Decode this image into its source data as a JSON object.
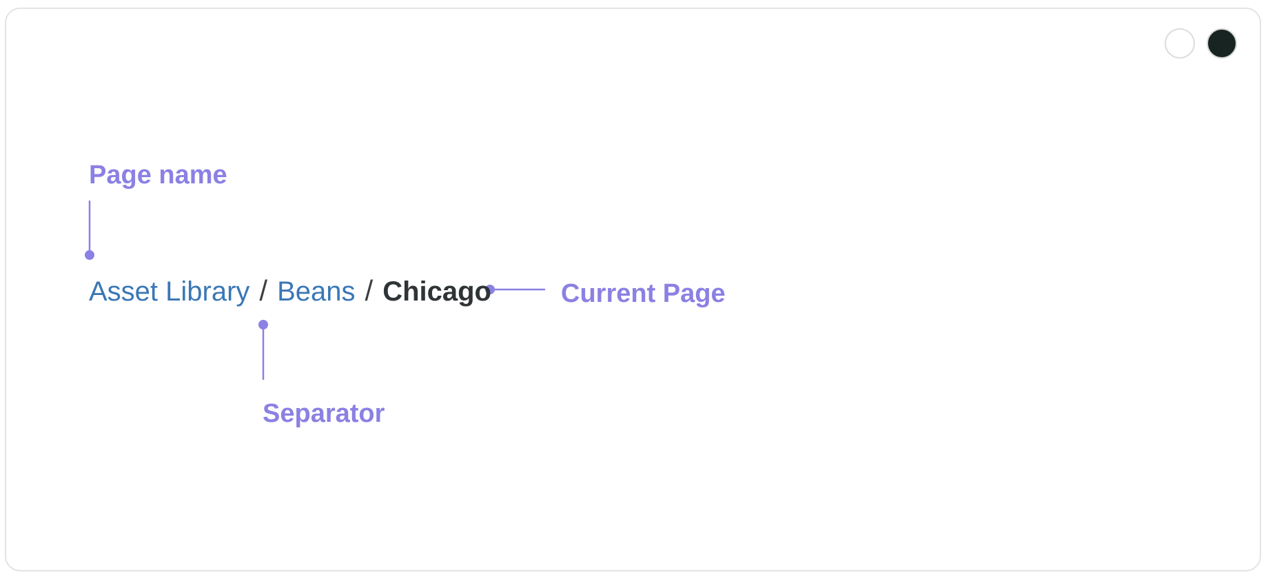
{
  "colors": {
    "annotation": "#8b80e3",
    "link": "#3a77b6",
    "separator": "#3b3f42",
    "current": "#2f3437",
    "frame_border": "#e3e3e3",
    "toggle_dark": "#172422"
  },
  "annotations": {
    "page_name": "Page name",
    "current_page": "Current Page",
    "separator": "Separator"
  },
  "breadcrumb": {
    "items": [
      {
        "label": "Asset Library",
        "link": true
      },
      {
        "label": "Beans",
        "link": true
      },
      {
        "label": "Chicago",
        "link": false
      }
    ],
    "separator": "/"
  }
}
